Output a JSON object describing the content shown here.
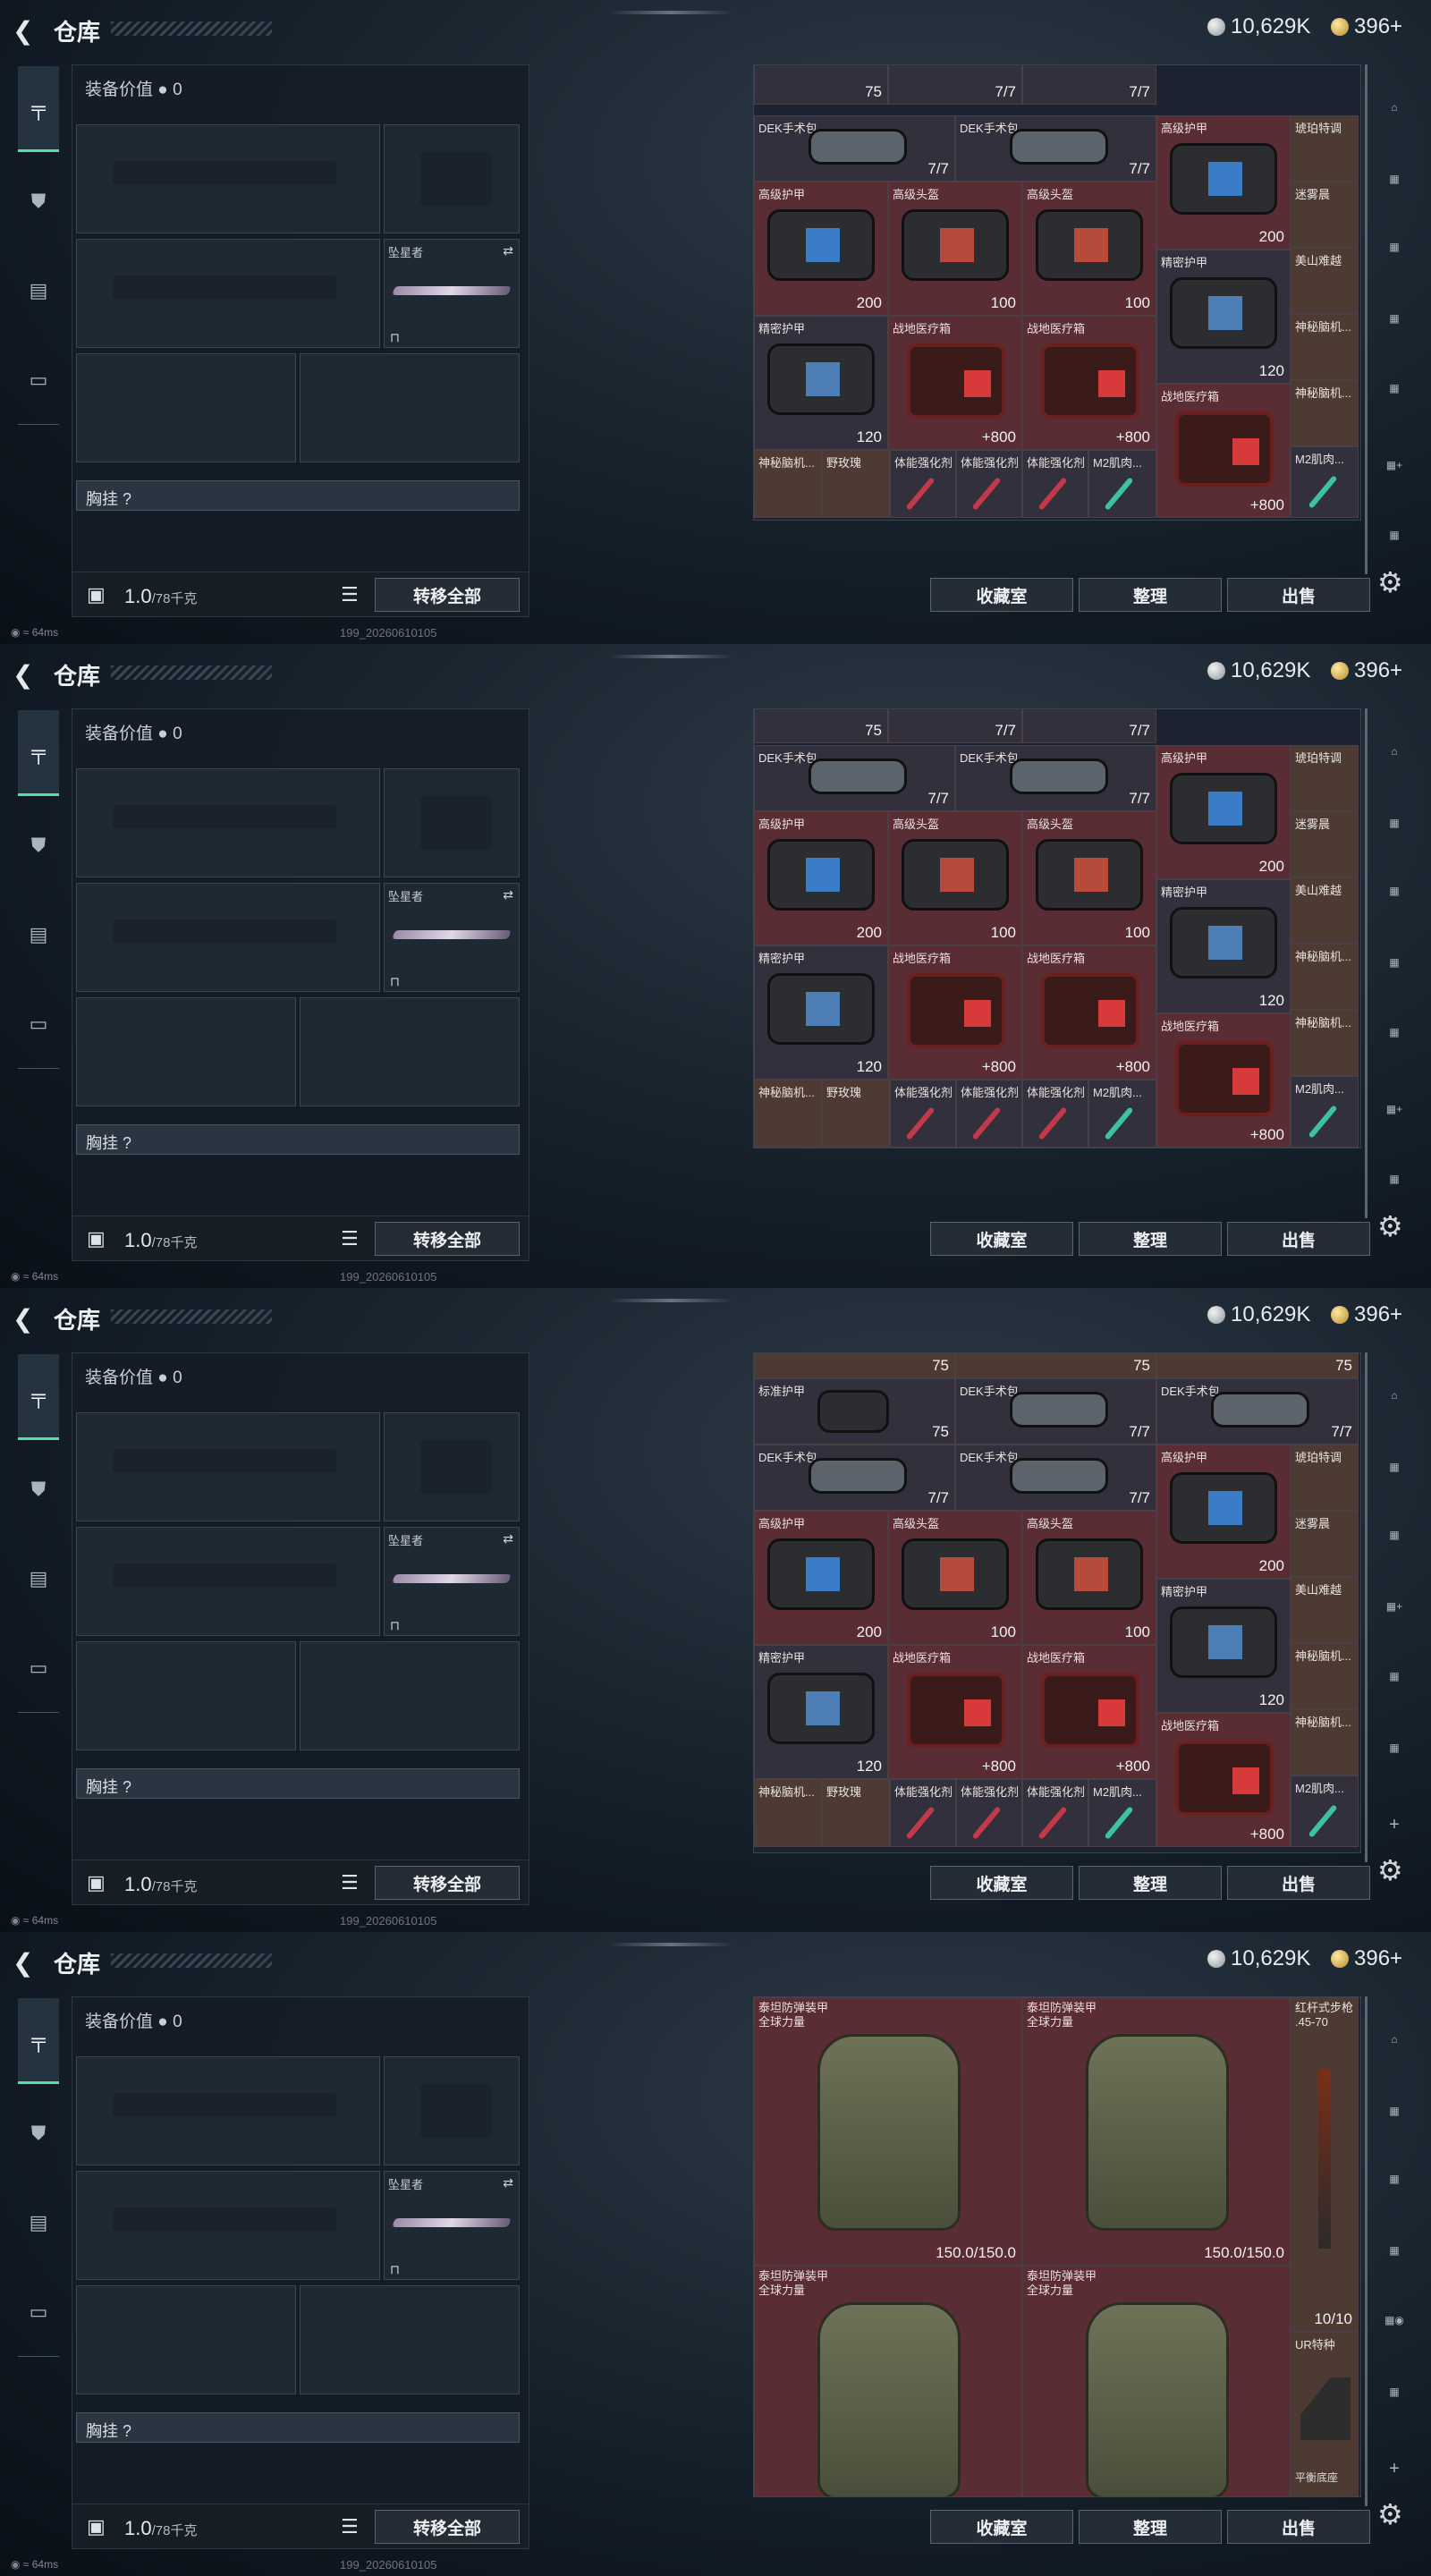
{
  "header": {
    "back_icon": "chevron-left-icon",
    "title": "仓库",
    "silver": "10,629K",
    "gold": "396+"
  },
  "equip": {
    "title": "装备价值",
    "value": "0",
    "knife_label": "坠星者",
    "chest_label": "胸挂 ?",
    "weight": "1.0",
    "weight_max": "/78千克",
    "transfer_all": "转移全部"
  },
  "footer": {
    "collection": "收藏室",
    "sort": "整理",
    "sell": "出售"
  },
  "status": {
    "ping": "64ms",
    "build": "199_20260610105"
  },
  "items": {
    "dek_kit": "DEK手术包",
    "adv_armor": "高级护甲",
    "adv_helmet": "高级头盔",
    "precise_armor": "精密护甲",
    "field_med": "战地医疗箱",
    "amber": "琥珀特调",
    "mist": "迷雾晨",
    "mountain": "美山难越",
    "mystery": "神秘脑机...",
    "wild": "野玫瑰",
    "stam": "体能强化剂",
    "m2": "M2肌肉...",
    "std_armor": "标准护甲",
    "titan": "泰坦防弹装甲\n全球力量",
    "red_rifle": "红杆式步枪\n.45-70",
    "ur": "UR特种",
    "balance": "平衡底座"
  },
  "values": {
    "v75": "75",
    "v77": "7/7",
    "v200": "200",
    "v100": "100",
    "v120": "120",
    "v800": "+800",
    "v150": "150.0/150.0",
    "v1010": "10/10"
  },
  "colors": {
    "accent": "#4fe0a8",
    "red_cell": "#5a2c33",
    "dark_cell": "#32303c"
  }
}
